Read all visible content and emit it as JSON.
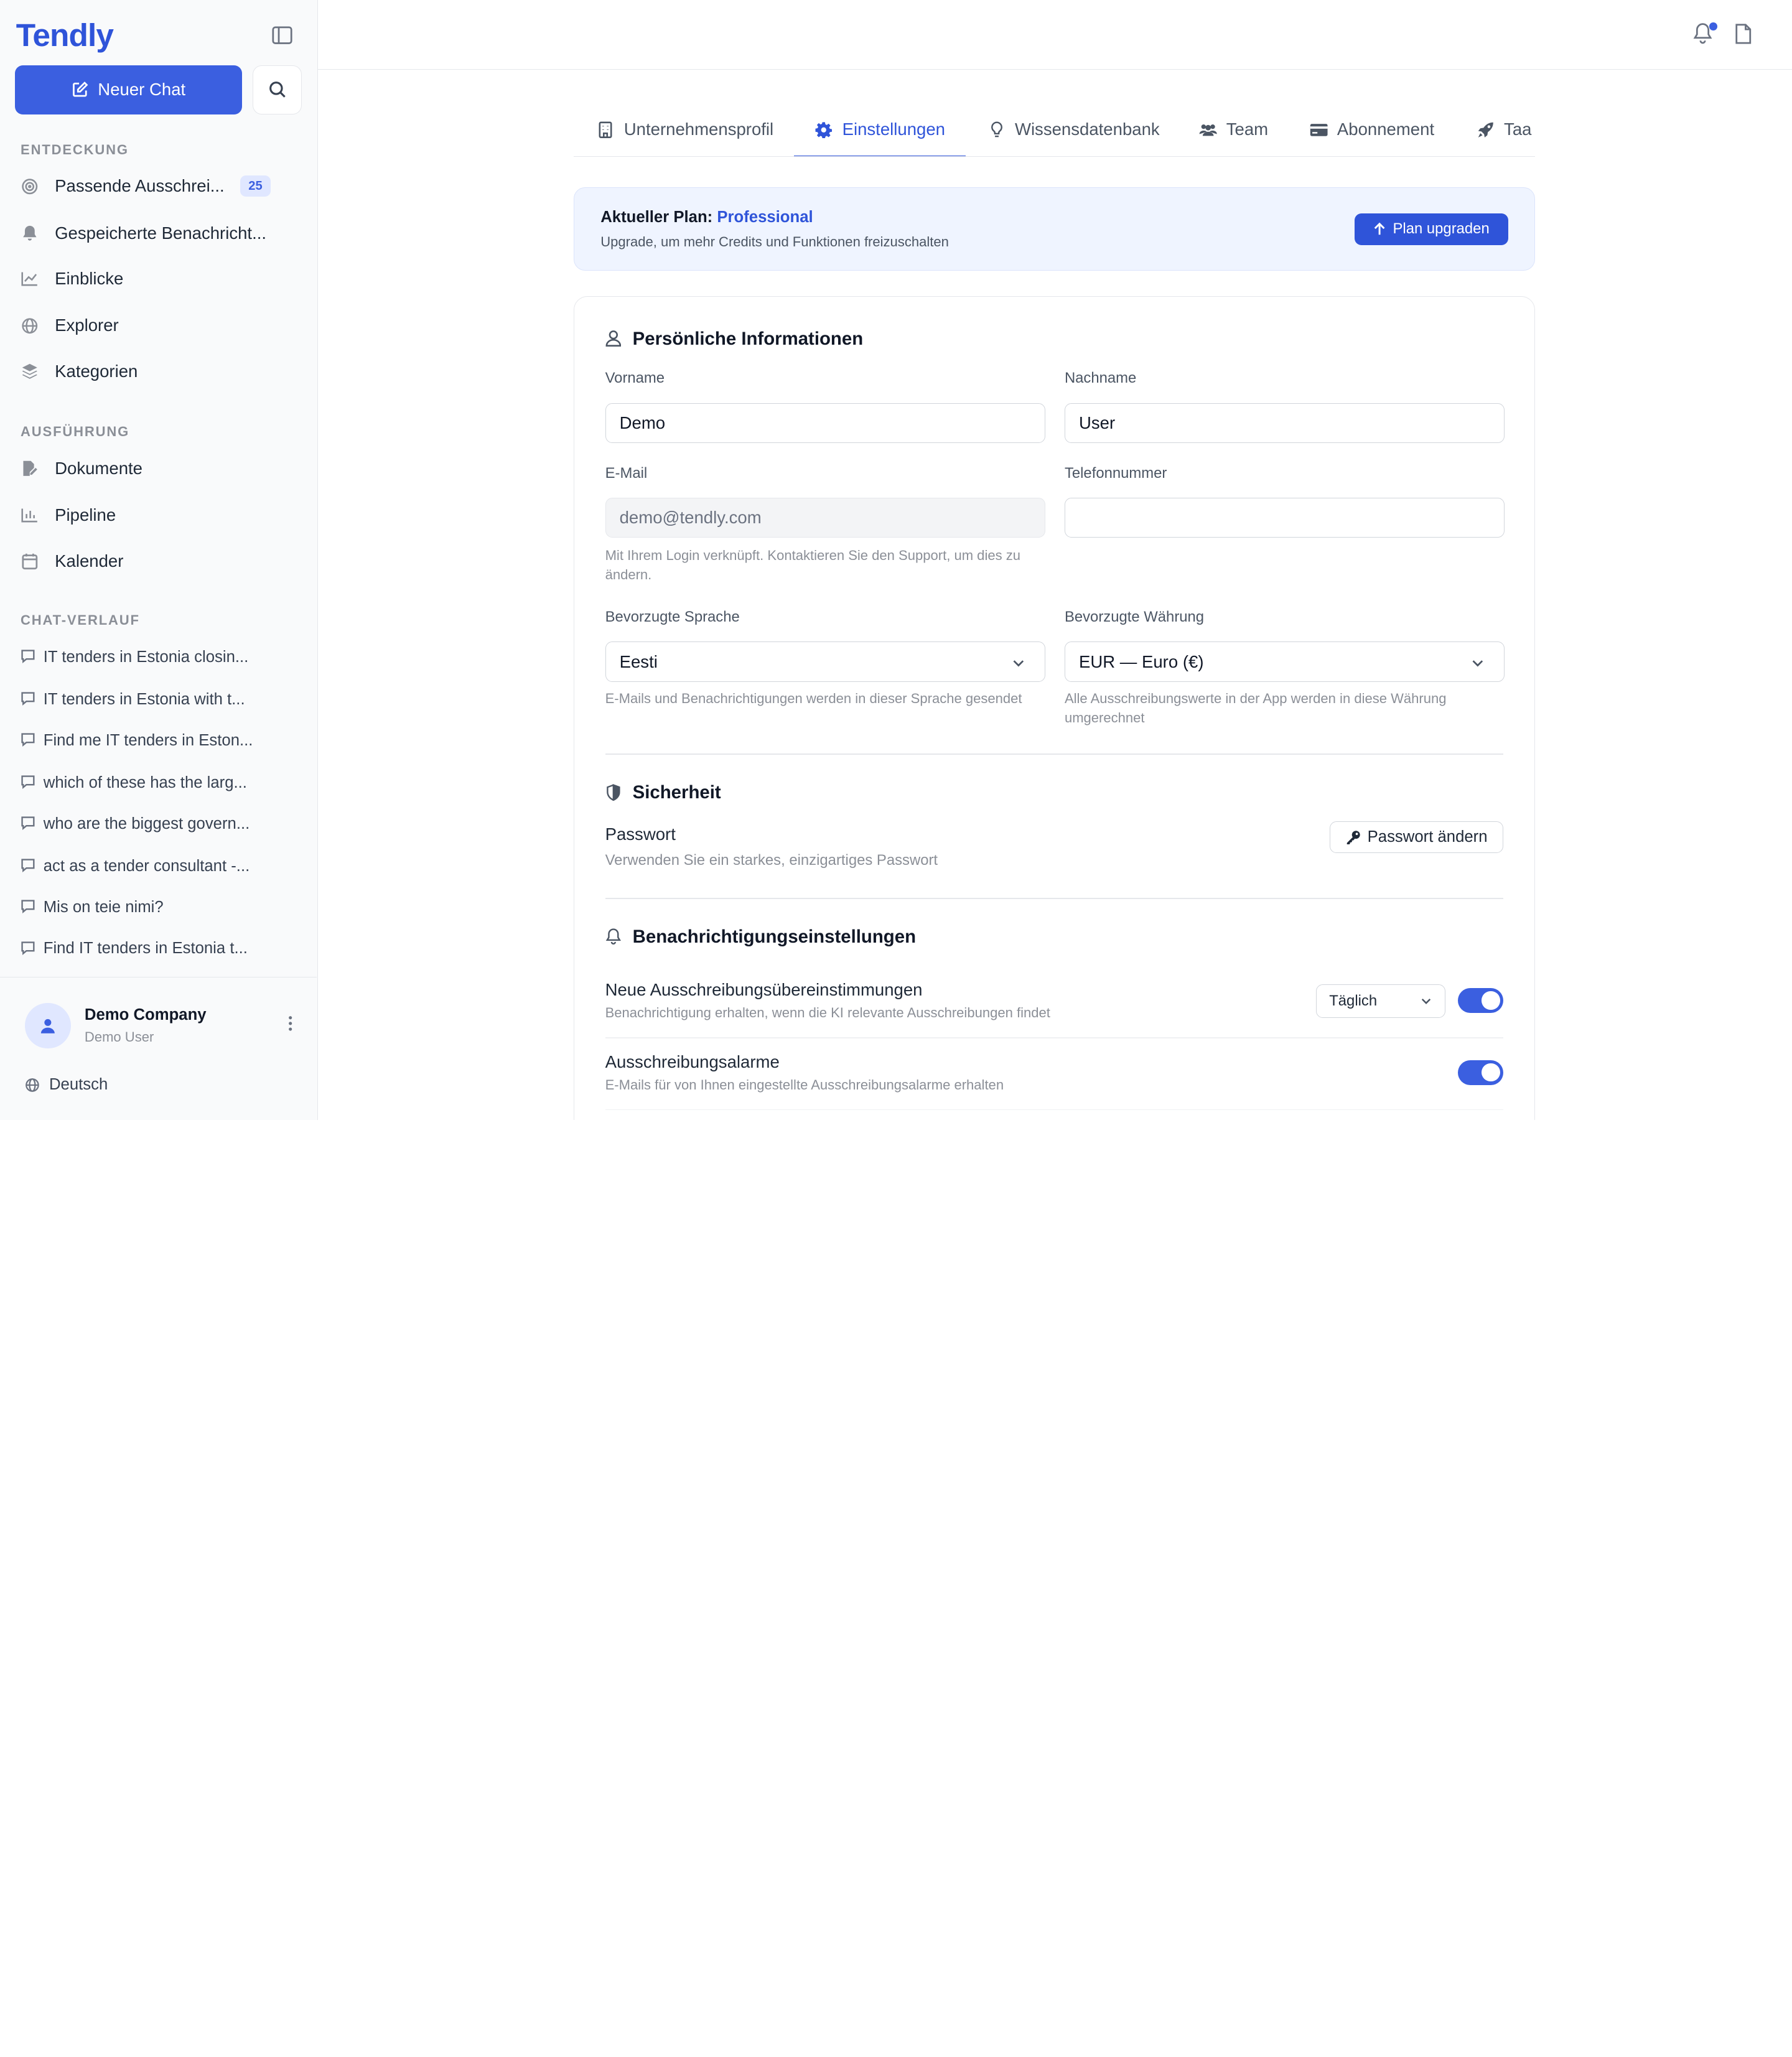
{
  "sidebar": {
    "brand": "Tendly",
    "new_chat_label": "Neuer Chat",
    "sections": {
      "discovery": "ENTDECKUNG",
      "execution": "AUSFÜHRUNG",
      "chat_history": "CHAT-VERLAUF"
    },
    "discovery_items": [
      {
        "label": "Passende Ausschrei...",
        "icon": "target-icon",
        "badge": "25"
      },
      {
        "label": "Gespeicherte Benachricht...",
        "icon": "bell-icon"
      },
      {
        "label": "Einblicke",
        "icon": "chart-line-icon"
      },
      {
        "label": "Explorer",
        "icon": "globe-icon"
      },
      {
        "label": "Kategorien",
        "icon": "layers-icon"
      }
    ],
    "execution_items": [
      {
        "label": "Dokumente",
        "icon": "file-edit-icon"
      },
      {
        "label": "Pipeline",
        "icon": "bar-chart-icon"
      },
      {
        "label": "Kalender",
        "icon": "calendar-icon"
      }
    ],
    "chats": [
      "IT tenders in Estonia closin...",
      "IT tenders in Estonia with t...",
      "Find me IT tenders in Eston...",
      "which of these has the larg...",
      "who are the biggest govern...",
      "act as a tender consultant -...",
      "Mis on teie nimi?",
      "Find IT tenders in Estonia t..."
    ],
    "footer": {
      "company": "Demo Company",
      "user": "Demo User",
      "language": "Deutsch"
    }
  },
  "tabs": [
    {
      "label": "Unternehmensprofil",
      "icon": "building-icon",
      "active": false
    },
    {
      "label": "Einstellungen",
      "icon": "gear-icon",
      "active": true
    },
    {
      "label": "Wissensdatenbank",
      "icon": "lightbulb-icon",
      "active": false
    },
    {
      "label": "Team",
      "icon": "users-icon",
      "active": false
    },
    {
      "label": "Abonnement",
      "icon": "credit-card-icon",
      "active": false
    },
    {
      "label": "Taa",
      "icon": "rocket-icon",
      "active": false
    }
  ],
  "plan": {
    "prefix": "Aktueller Plan:",
    "name": "Professional",
    "description": "Upgrade, um mehr Credits und Funktionen freizuschalten",
    "upgrade_label": "Plan upgraden"
  },
  "personal": {
    "title": "Persönliche Informationen",
    "first_name_label": "Vorname",
    "first_name_value": "Demo",
    "last_name_label": "Nachname",
    "last_name_value": "User",
    "email_label": "E-Mail",
    "email_value": "demo@tendly.com",
    "email_help": "Mit Ihrem Login verknüpft. Kontaktieren Sie den Support, um dies zu ändern.",
    "phone_label": "Telefonnummer",
    "phone_value": "",
    "language_label": "Bevorzugte Sprache",
    "language_value": "Eesti",
    "language_help": "E-Mails und Benachrichtigungen werden in dieser Sprache gesendet",
    "currency_label": "Bevorzugte Währung",
    "currency_value": "EUR — Euro (€)",
    "currency_help": "Alle Ausschreibungswerte in der App werden in diese Währung umgerechnet"
  },
  "security": {
    "title": "Sicherheit",
    "password_label": "Passwort",
    "password_desc": "Verwenden Sie ein starkes, einzigartiges Passwort",
    "change_password_label": "Passwort ändern"
  },
  "notifications": {
    "title": "Benachrichtigungseinstellungen",
    "items": [
      {
        "title": "Neue Ausschreibungsübereinstimmungen",
        "desc": "Benachrichtigung erhalten, wenn die KI relevante Ausschreibungen findet",
        "frequency": "Täglich",
        "enabled": true
      },
      {
        "title": "Ausschreibungsalarme",
        "desc": "E-Mails für von Ihnen eingestellte Ausschreibungsalarme erhalten",
        "enabled": true
      }
    ]
  },
  "colors": {
    "accent": "#2f54d9",
    "primary_button": "#3b5fe0",
    "banner_bg": "#eff4ff"
  }
}
